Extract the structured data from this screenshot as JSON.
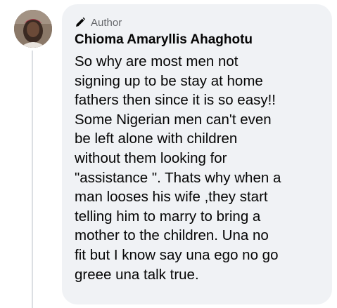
{
  "comment": {
    "badge_label": "Author",
    "badge_icon": "pencil-icon",
    "author_name": "Chioma Amaryllis Ahaghotu",
    "text_lines": [
      "So why are most men not",
      "signing up to be stay at home",
      "fathers then since it is so easy!!",
      "Some Nigerian men can't even",
      "be left alone with children",
      "without them looking for",
      "\"assistance \". Thats why when a",
      "man looses his wife ,they start",
      "telling him to marry to bring a",
      "mother to the children. Una no",
      "fit but I know say una ego no go",
      "greee una talk true."
    ]
  },
  "colors": {
    "bubble_bg": "#f0f2f5",
    "text": "#050505",
    "secondary_text": "#65676b"
  }
}
